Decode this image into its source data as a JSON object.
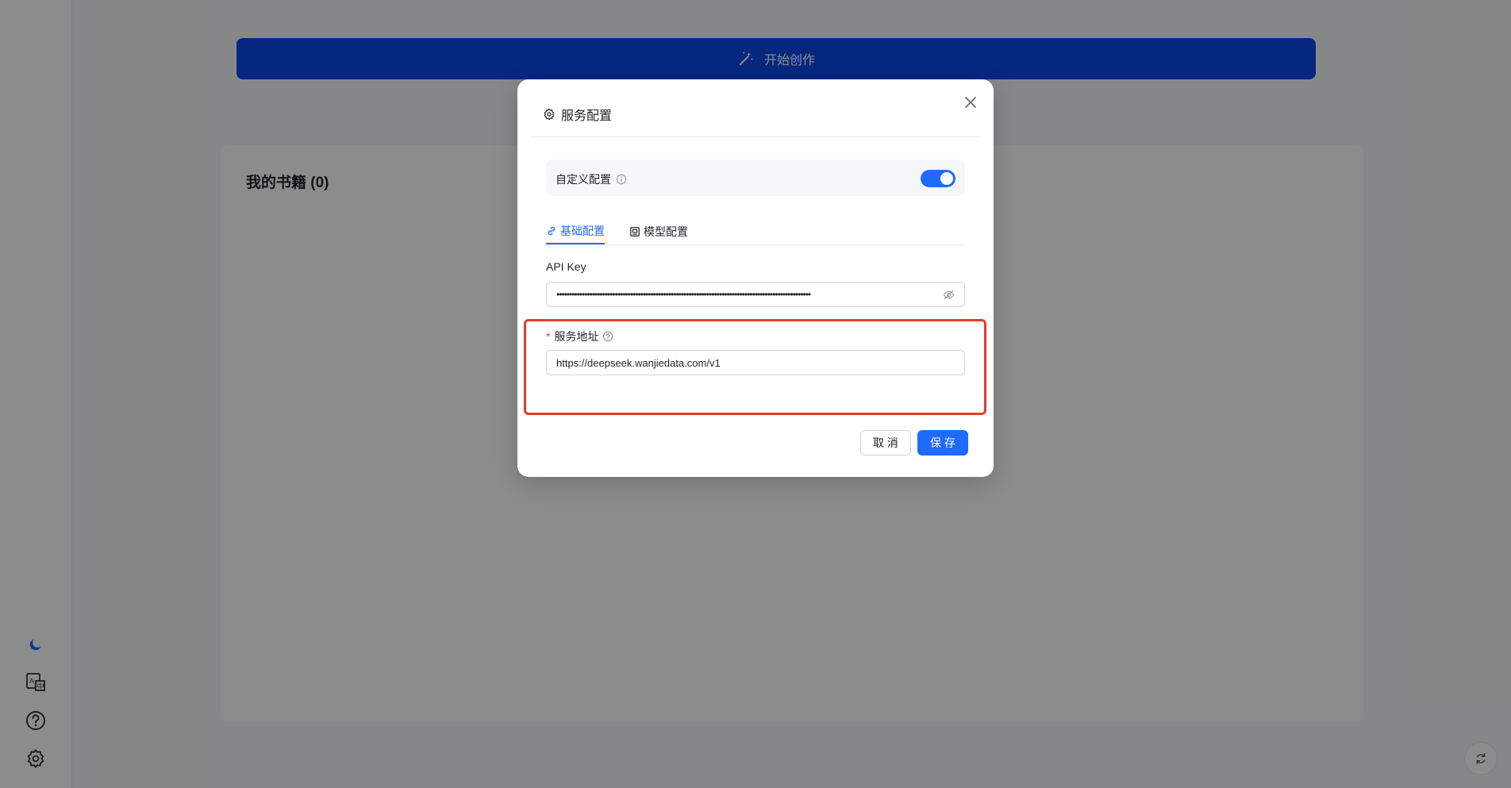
{
  "main": {
    "start_button_label": "开始创作",
    "books_title": "我的书籍 (0)"
  },
  "sidebar": {
    "icons": [
      "moon-icon",
      "translate-icon",
      "help-icon",
      "settings-icon"
    ]
  },
  "modal": {
    "title": "服务配置",
    "custom_config_label": "自定义配置",
    "custom_config_enabled": true,
    "tabs": [
      {
        "label": "基础配置",
        "active": true
      },
      {
        "label": "模型配置",
        "active": false
      }
    ],
    "api_key_label": "API Key",
    "api_key_value": "••••••••••••••••••••••••••••••••••••••••••••••••••••••••••••••••••••••••••••••••••••••••••••••••••••",
    "service_url_required_mark": "*",
    "service_url_label": "服务地址",
    "service_url_value": "https://deepseek.wanjiedata.com/v1",
    "cancel_label": "取 消",
    "save_label": "保 存"
  },
  "colors": {
    "primary": "#1f6bff",
    "start_button": "#0a47e6",
    "highlight_border": "#e53b2c",
    "required": "#e53b2c"
  }
}
